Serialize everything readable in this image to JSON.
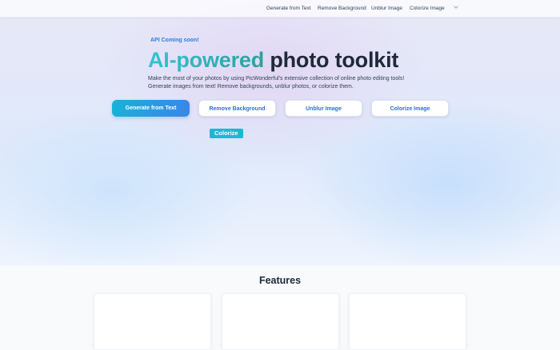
{
  "nav": {
    "links": [
      "Generate from Text",
      "Remove Background",
      "Unblur Image",
      "Colorize Image"
    ],
    "more_icon": "chevron-down-icon"
  },
  "hero": {
    "badge": "API Coming soon!",
    "title_accent": "AI-powered",
    "title_rest": "photo toolkit",
    "description_line1": "Make the most of your photos by using PicWonderful's extensive collection of online photo editing tools!",
    "description_line2": "Generate images from text! Remove backgrounds, unblur photos, or colorize them.",
    "buttons": [
      "Generate from Text",
      "Remove Background",
      "Unblur Image",
      "Colorize Image"
    ],
    "chip": "Colorize"
  },
  "features": {
    "title": "Features"
  },
  "colors": {
    "accent": "#1fb6d6",
    "primary_button": "#3a86e8",
    "link_blue": "#2a6fdb",
    "heading": "#1f2937"
  }
}
